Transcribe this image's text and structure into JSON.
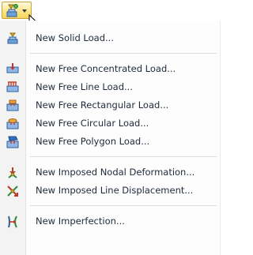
{
  "toolbar": {
    "button_icon": "new-load-icon",
    "dropdown_icon": "chevron-down-icon"
  },
  "menu": {
    "items": [
      {
        "label": "New Solid Load...",
        "icon": "solid-load-icon"
      },
      {
        "label": "New Free Concentrated Load...",
        "icon": "free-concentrated-load-icon"
      },
      {
        "label": "New Free Line Load...",
        "icon": "free-line-load-icon"
      },
      {
        "label": "New Free Rectangular Load...",
        "icon": "free-rectangular-load-icon"
      },
      {
        "label": "New Free Circular Load...",
        "icon": "free-circular-load-icon"
      },
      {
        "label": "New Free Polygon Load...",
        "icon": "free-polygon-load-icon"
      },
      {
        "label": "New Imposed Nodal Deformation...",
        "icon": "imposed-nodal-deformation-icon"
      },
      {
        "label": "New Imposed Line Displacement...",
        "icon": "imposed-line-displacement-icon"
      },
      {
        "label": "New Imperfection...",
        "icon": "imperfection-icon"
      }
    ]
  }
}
